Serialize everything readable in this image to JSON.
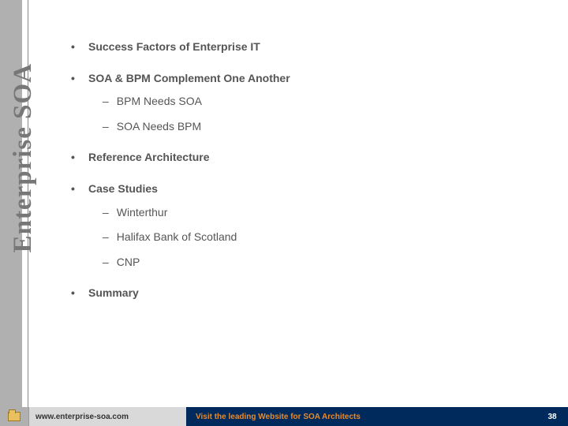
{
  "sidebar": {
    "title": "Enterprise SOA"
  },
  "agenda": {
    "items": [
      {
        "label": "Success Factors of Enterprise IT",
        "sub": []
      },
      {
        "label": "SOA & BPM Complement One Another",
        "sub": [
          "BPM Needs SOA",
          "SOA Needs BPM"
        ]
      },
      {
        "label": "Reference Architecture",
        "sub": []
      },
      {
        "label": "Case Studies",
        "sub": [
          "Winterthur",
          "Halifax Bank of Scotland",
          "CNP"
        ]
      },
      {
        "label": "Summary",
        "sub": [],
        "highlight": true
      }
    ]
  },
  "footer": {
    "url": "www.enterprise-soa.com",
    "tagline": "Visit the leading Website for SOA Architects",
    "page": "38"
  }
}
